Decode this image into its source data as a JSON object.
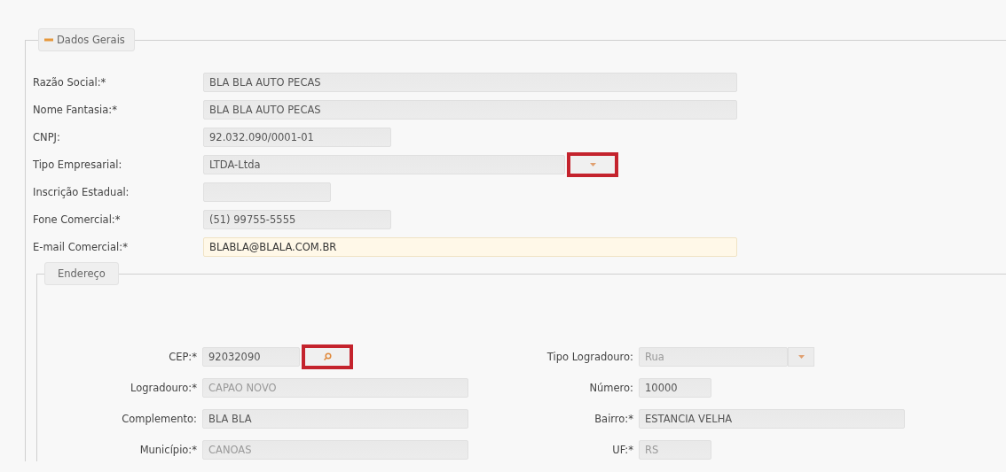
{
  "general": {
    "legend": "Dados Gerais",
    "expanded": true,
    "fields": [
      {
        "label": "Razão Social:*",
        "value": "BLA BLA AUTO PECAS",
        "kind": "text",
        "disabled": false,
        "focused": false
      },
      {
        "label": "Nome Fantasia:*",
        "value": "BLA BLA AUTO PECAS",
        "kind": "text",
        "disabled": false,
        "focused": false
      },
      {
        "label": "CNPJ:",
        "value": "92.032.090/0001-01",
        "kind": "text",
        "disabled": false,
        "focused": false
      },
      {
        "label": "Tipo Empresarial:",
        "value": "LTDA-Ltda",
        "kind": "combo",
        "disabled": false,
        "focused": false,
        "highlighted": true
      },
      {
        "label": "Inscrição Estadual:",
        "kind": "text",
        "disabled": false,
        "focused": false
      },
      {
        "label": "Fone Comercial:*",
        "value": "(51) 99755-5555",
        "kind": "text",
        "disabled": false,
        "focused": false
      },
      {
        "label": "E-mail Comercial:*",
        "value": "BLABLA@BLALA.COM.BR",
        "kind": "text",
        "disabled": false,
        "focused": true
      }
    ]
  },
  "address": {
    "legend": "Endereço",
    "left": [
      {
        "label": "CEP:*",
        "value": "92032090",
        "kind": "lookup",
        "disabled": false,
        "highlighted": true
      },
      {
        "label": "Logradouro:*",
        "value": "CAPAO NOVO",
        "kind": "text",
        "disabled": true
      },
      {
        "label": "Complemento:",
        "value": "BLA BLA",
        "kind": "text",
        "disabled": false
      },
      {
        "label": "Município:*",
        "value": "CANOAS",
        "kind": "text",
        "disabled": true
      }
    ],
    "right": [
      {
        "label": "Tipo Logradouro:",
        "value": "Rua",
        "kind": "combo",
        "disabled": true,
        "highlighted": false
      },
      {
        "label": "Número:",
        "value": "10000",
        "kind": "text",
        "disabled": false
      },
      {
        "label": "Bairro:*",
        "value": "ESTANCIA VELHA",
        "kind": "text",
        "disabled": false
      },
      {
        "label": "UF:*",
        "value": "RS",
        "kind": "text",
        "disabled": true
      }
    ]
  }
}
